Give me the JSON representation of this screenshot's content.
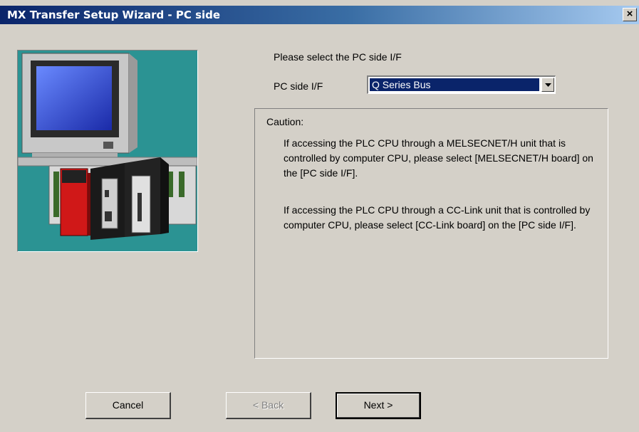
{
  "window": {
    "title": "MX Transfer Setup Wizard - PC side",
    "close_glyph": "×"
  },
  "main": {
    "prompt": "Please select the PC side I/F",
    "if_label": "PC side I/F",
    "if_select": {
      "value": "Q Series Bus",
      "icon": "dropdown-arrow-icon"
    }
  },
  "caution": {
    "title": "Caution:",
    "paragraph1": "If accessing the PLC CPU through a MELSECNET/H unit that is controlled by computer CPU, please select [MELSECNET/H board] on the [PC side I/F].",
    "paragraph2": "If accessing the PLC CPU through a CC-Link unit that is controlled by computer CPU, please select [CC-Link board] on the [PC side I/F]."
  },
  "buttons": {
    "cancel": "Cancel",
    "back": "< Back",
    "next": "Next >"
  },
  "colors": {
    "titlebar_start": "#0a246a",
    "titlebar_end": "#a6caf0",
    "dialog_bg": "#d4d0c8",
    "illustration_bg": "#2b9393"
  }
}
